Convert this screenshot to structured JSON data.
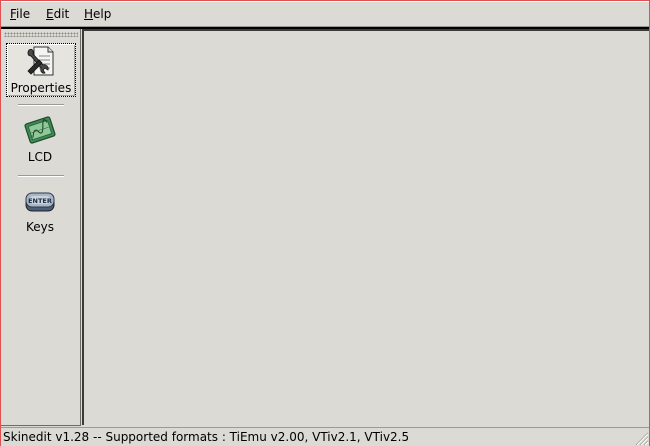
{
  "menubar": {
    "items": [
      {
        "accel": "F",
        "rest": "ile"
      },
      {
        "accel": "E",
        "rest": "dit"
      },
      {
        "accel": "H",
        "rest": "elp"
      }
    ]
  },
  "toolbar": {
    "buttons": [
      {
        "label": "Properties",
        "icon": "properties-icon",
        "selected": true
      },
      {
        "label": "LCD",
        "icon": "lcd-icon",
        "selected": false
      },
      {
        "label": "Keys",
        "icon": "keys-icon",
        "selected": false
      }
    ]
  },
  "statusbar": {
    "text": "Skinedit v1.28 -- Supported formats : TiEmu v2.00, VTiv2.1, VTiv2.5"
  },
  "colors": {
    "window_bg": "#dcdad5",
    "window_border": "#e05050",
    "lcd_green": "#3e8a55"
  }
}
